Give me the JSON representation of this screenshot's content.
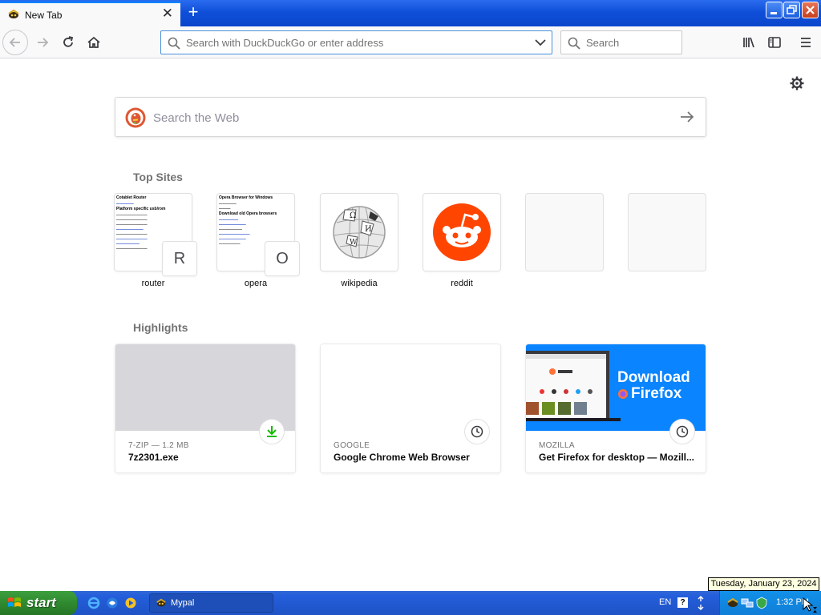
{
  "browser": {
    "tab": {
      "title": "New Tab",
      "close": "✕"
    },
    "new_tab": "+",
    "urlbar": {
      "placeholder": "Search with DuckDuckGo or enter address"
    },
    "searchbar": {
      "placeholder": "Search"
    }
  },
  "newtab": {
    "web_search": {
      "placeholder": "Search the Web"
    },
    "top_sites": {
      "title": "Top Sites",
      "sites": [
        {
          "label": "router",
          "letter": "R"
        },
        {
          "label": "opera",
          "letter": "O"
        },
        {
          "label": "wikipedia"
        },
        {
          "label": "reddit"
        }
      ]
    },
    "highlights": {
      "title": "Highlights",
      "cards": [
        {
          "context": "7-ZIP — 1.2 MB",
          "title": "7z2301.exe",
          "badge_icon": "download-icon"
        },
        {
          "context": "GOOGLE",
          "title": "Google Chrome Web Browser",
          "badge_icon": "clock-icon"
        },
        {
          "context": "MOZILLA",
          "title": "Get Firefox for desktop — Mozill...",
          "badge_icon": "clock-icon"
        }
      ],
      "firefox_banner": {
        "line1": "Download",
        "line2": "Firefox"
      }
    }
  },
  "taskbar": {
    "start": "start",
    "window": "Mypal",
    "language": "EN",
    "help": "?",
    "clock": "1:32 PM",
    "tooltip": "Tuesday, January 23, 2024"
  },
  "colors": {
    "accent": "#0a84ff",
    "taskbar": "#245edb",
    "start": "#2f8a2f",
    "reddit": "#ff4500",
    "firefox_blue": "#0a84ff"
  }
}
